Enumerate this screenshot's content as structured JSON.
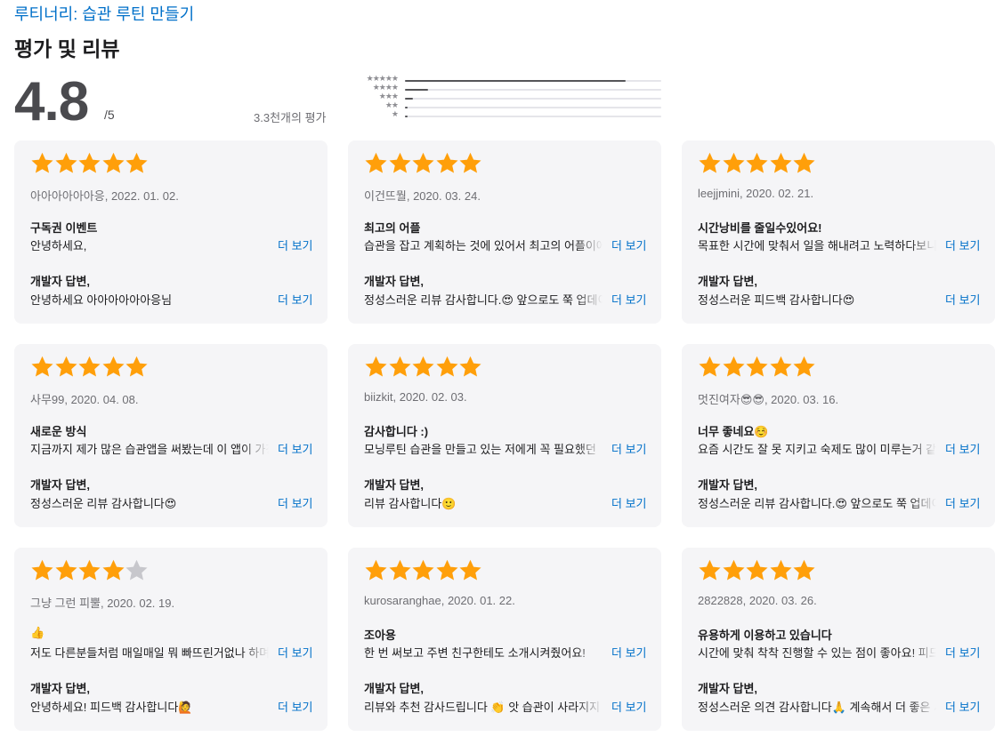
{
  "app_link": "루티너리: 습관 루틴 만들기",
  "section_title": "평가 및 리뷰",
  "summary": {
    "rating": "4.8",
    "out_of": "/5",
    "count": "3.3천개의 평가",
    "histogram": [
      {
        "stars": "★★★★★",
        "fraction": 0.86
      },
      {
        "stars": "★★★★",
        "fraction": 0.09
      },
      {
        "stars": "★★★",
        "fraction": 0.03
      },
      {
        "stars": "★★",
        "fraction": 0.01
      },
      {
        "stars": "★",
        "fraction": 0.01
      }
    ]
  },
  "colors": {
    "star_filled": "#ff9f0a",
    "star_empty": "#c7c7cc",
    "link": "#0070c9"
  },
  "more_label": "더 보기",
  "reviews": [
    {
      "rating": 5,
      "meta": "아아아아아아응, 2022. 01. 02.",
      "title": "구독권 이벤트",
      "body": "안녕하세요,",
      "dev_label": "개발자 답변,",
      "reply": "안녕하세요 아아아아아아응님"
    },
    {
      "rating": 5,
      "meta": "이건뜨뭘, 2020. 03. 24.",
      "title": "최고의 어플",
      "body": "습관을 잡고 계획하는 것에 있어서 최고의 어플이에요",
      "dev_label": "개발자 답변,",
      "reply": "정성스러운 리뷰 감사합니다.😍 앞으로도 쭉 업데이트"
    },
    {
      "rating": 5,
      "meta": "leejjmini, 2020. 02. 21.",
      "title": "시간낭비를 줄일수있어요!",
      "body": "목표한 시간에 맞춰서 일을 해내려고 노력하다보니 …",
      "dev_label": "개발자 답변,",
      "reply": "정성스러운 피드백 감사합니다😍"
    },
    {
      "rating": 5,
      "meta": "사무99, 2020. 04. 08.",
      "title": "새로운 방식",
      "body": "지금까지 제가 많은 습관앱을 써봤는데 이 앱이 가장",
      "dev_label": "개발자 답변,",
      "reply": "정성스러운 리뷰 감사합니다😍"
    },
    {
      "rating": 5,
      "meta": "biizkit, 2020. 02. 03.",
      "title": "감사합니다 :)",
      "body": "모닝루틴 습관을 만들고 있는 저에게 꼭 필요했던",
      "dev_label": "개발자 답변,",
      "reply": "리뷰 감사합니다🙂"
    },
    {
      "rating": 5,
      "meta": "멋진여자😎😎, 2020. 03. 16.",
      "title": "너무 좋네요☺️",
      "body": "요즘 시간도 잘 못 지키고 숙제도 많이 미루는거 같아서",
      "dev_label": "개발자 답변,",
      "reply": "정성스러운 리뷰 감사합니다.😍 앞으로도 쭉 업데이트"
    },
    {
      "rating": 4,
      "meta": "그냥 그런 피뿔, 2020. 02. 19.",
      "title": "👍",
      "body": "저도 다른분들처럼 매일매일 뭐 빠뜨린거없나 하며 살",
      "dev_label": "개발자 답변,",
      "reply": "안녕하세요! 피드백 감사합니다🙋"
    },
    {
      "rating": 5,
      "meta": "kurosaranghae, 2020. 01. 22.",
      "title": "조아용",
      "body": "한 번 써보고 주변 친구한테도 소개시켜줬어요!",
      "dev_label": "개발자 답변,",
      "reply": "리뷰와 추천 감사드립니다 👏 앗 습관이 사라지지 않도록"
    },
    {
      "rating": 5,
      "meta": "2822828, 2020. 03. 26.",
      "title": "유용하게 이용하고 있습니다",
      "body": "시간에 맞춰 착착 진행할 수 있는 점이 좋아요! 피드백",
      "dev_label": "개발자 답변,",
      "reply": "정성스러운 의견 감사합니다🙏 계속해서 더 좋은 서비스"
    }
  ]
}
